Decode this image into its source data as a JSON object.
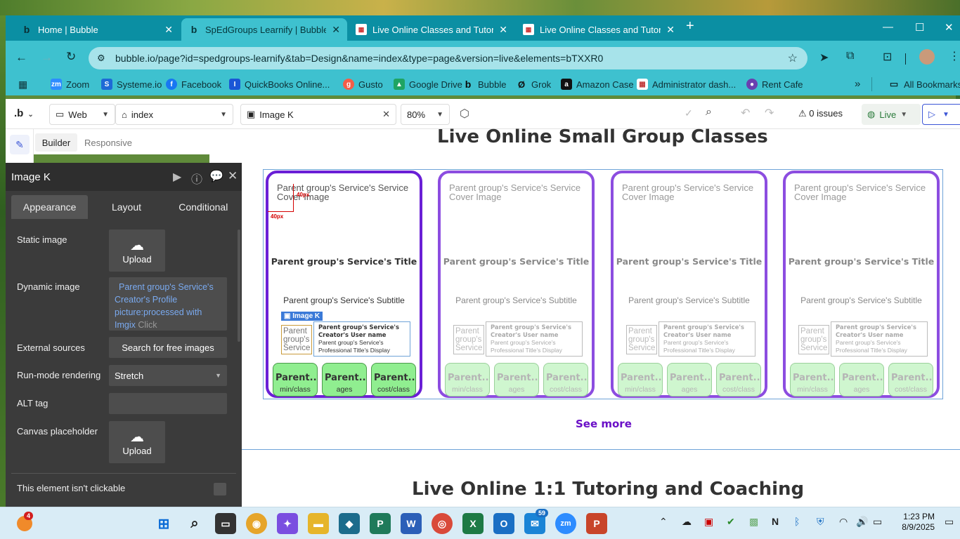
{
  "browser": {
    "tabs": [
      {
        "title": "Home | Bubble",
        "active": false
      },
      {
        "title": "SpEdGroups Learnify | Bubble E",
        "active": true
      },
      {
        "title": "Live Online Classes and Tutorin",
        "active": false
      },
      {
        "title": "Live Online Classes and Tutorin",
        "active": false
      }
    ],
    "new_tab": "+",
    "url": "bubble.io/page?id=spedgroups-learnify&tab=Design&name=index&type=page&version=live&elements=bTXXR0",
    "bookmarks": [
      {
        "label": "Zoom",
        "icon": "zoom-icon",
        "color": "#2d8cff"
      },
      {
        "label": "Systeme.io",
        "icon": "systeme-icon",
        "color": "#1e6ad6"
      },
      {
        "label": "Facebook",
        "icon": "facebook-icon",
        "color": "#1877f2"
      },
      {
        "label": "QuickBooks Online...",
        "icon": "quickbooks-icon",
        "color": "#2ca01c"
      },
      {
        "label": "Gusto",
        "icon": "gusto-icon",
        "color": "#f45d48"
      },
      {
        "label": "Google Drive",
        "icon": "google-drive-icon",
        "color": "#1fa463"
      },
      {
        "label": "Bubble",
        "icon": "bubble-icon",
        "color": "#0b0b0b"
      },
      {
        "label": "Grok",
        "icon": "grok-icon",
        "color": "#111111"
      },
      {
        "label": "Amazon Case",
        "icon": "amazon-icon",
        "color": "#111111"
      },
      {
        "label": "Administrator dash...",
        "icon": "admin-icon",
        "color": "#c03a3a"
      },
      {
        "label": "Rent Cafe",
        "icon": "rentcafe-icon",
        "color": "#6a3fb0"
      }
    ],
    "all_bookmarks": "All Bookmarks"
  },
  "editor": {
    "logo": ".b",
    "platform": "Web",
    "page": "index",
    "selected_element": "Image K",
    "zoom": "80%",
    "issues": "0 issues",
    "live": "Live",
    "builder_tab": "Builder",
    "responsive_tab": "Responsive"
  },
  "panel": {
    "title": "Image K",
    "tabs": [
      "Appearance",
      "Layout",
      "Conditional"
    ],
    "static_image_label": "Static image",
    "upload": "Upload",
    "dynamic_image_label": "Dynamic image",
    "dynamic_image_value": "Parent group's Service's Creator's Profile picture:processed with Imgix",
    "click_hint": "Click",
    "external_sources_label": "External sources",
    "search_free_images": "Search for free images",
    "run_mode_label": "Run-mode rendering",
    "run_mode_value": "Stretch",
    "alt_tag_label": "ALT tag",
    "alt_tag_value": "",
    "canvas_placeholder_label": "Canvas placeholder",
    "not_clickable_label": "This element isn't clickable"
  },
  "canvas": {
    "heading1": "Live Online Small Group Classes",
    "heading2": "Live Online 1:1 Tutoring and Coaching",
    "see_more": "See more",
    "selection_label": "Image K",
    "measure1": "40px",
    "measure2": "40px",
    "card": {
      "cover": "Parent group's Service's Service Cover Image",
      "title": "Parent group's Service's Title",
      "subtitle": "Parent group's Service's Subtitle",
      "profile_pic": "Parent group's Service",
      "creator": "Parent group's Service's Creator's User name",
      "professional": "Parent group's Service's Professional Title's Display",
      "pills": [
        {
          "value": "Parent...",
          "label": "min/class"
        },
        {
          "value": "Parent...",
          "label": "ages"
        },
        {
          "value": "Parent...",
          "label": "cost/class"
        }
      ]
    }
  },
  "taskbar": {
    "notification_badge": "4",
    "mail_badge": "59",
    "time": "1:23 PM",
    "date": "8/9/2025"
  }
}
